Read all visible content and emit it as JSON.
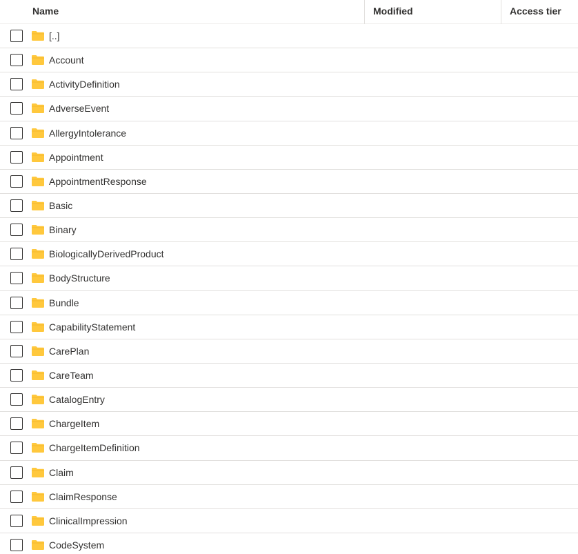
{
  "columns": {
    "name": "Name",
    "modified": "Modified",
    "access_tier": "Access tier"
  },
  "folder_icon_color": "#FFC83D",
  "rows": [
    {
      "name": "[..]",
      "icon": "folder-icon"
    },
    {
      "name": "Account",
      "icon": "folder-icon"
    },
    {
      "name": "ActivityDefinition",
      "icon": "folder-icon"
    },
    {
      "name": "AdverseEvent",
      "icon": "folder-icon"
    },
    {
      "name": "AllergyIntolerance",
      "icon": "folder-icon"
    },
    {
      "name": "Appointment",
      "icon": "folder-icon"
    },
    {
      "name": "AppointmentResponse",
      "icon": "folder-icon"
    },
    {
      "name": "Basic",
      "icon": "folder-icon"
    },
    {
      "name": "Binary",
      "icon": "folder-icon"
    },
    {
      "name": "BiologicallyDerivedProduct",
      "icon": "folder-icon"
    },
    {
      "name": "BodyStructure",
      "icon": "folder-icon"
    },
    {
      "name": "Bundle",
      "icon": "folder-icon"
    },
    {
      "name": "CapabilityStatement",
      "icon": "folder-icon"
    },
    {
      "name": "CarePlan",
      "icon": "folder-icon"
    },
    {
      "name": "CareTeam",
      "icon": "folder-icon"
    },
    {
      "name": "CatalogEntry",
      "icon": "folder-icon"
    },
    {
      "name": "ChargeItem",
      "icon": "folder-icon"
    },
    {
      "name": "ChargeItemDefinition",
      "icon": "folder-icon"
    },
    {
      "name": "Claim",
      "icon": "folder-icon"
    },
    {
      "name": "ClaimResponse",
      "icon": "folder-icon"
    },
    {
      "name": "ClinicalImpression",
      "icon": "folder-icon"
    },
    {
      "name": "CodeSystem",
      "icon": "folder-icon"
    }
  ]
}
